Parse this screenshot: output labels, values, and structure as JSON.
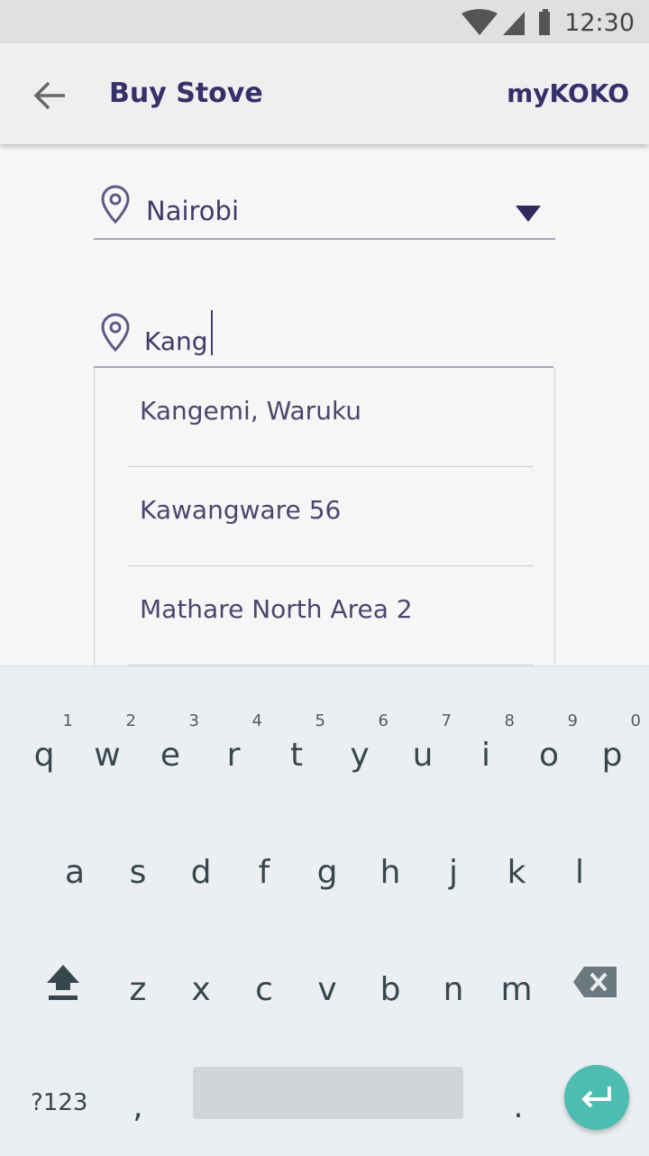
{
  "status_bar": {
    "time": "12:30"
  },
  "app_bar": {
    "title": "Buy Stove",
    "brand": "myKOKO"
  },
  "form": {
    "city_value": "Nairobi",
    "area_value": "Kang"
  },
  "suggestions": [
    "Kangemi, Waruku",
    "Kawangware 56",
    "Mathare North Area 2"
  ],
  "keyboard": {
    "row1": [
      {
        "key": "q",
        "num": "1"
      },
      {
        "key": "w",
        "num": "2"
      },
      {
        "key": "e",
        "num": "3"
      },
      {
        "key": "r",
        "num": "4"
      },
      {
        "key": "t",
        "num": "5"
      },
      {
        "key": "y",
        "num": "6"
      },
      {
        "key": "u",
        "num": "7"
      },
      {
        "key": "i",
        "num": "8"
      },
      {
        "key": "o",
        "num": "9"
      },
      {
        "key": "p",
        "num": "0"
      }
    ],
    "row2": [
      "a",
      "s",
      "d",
      "f",
      "g",
      "h",
      "j",
      "k",
      "l"
    ],
    "row3": [
      "z",
      "x",
      "c",
      "v",
      "b",
      "n",
      "m"
    ],
    "symbols_label": "?123",
    "comma": ",",
    "period": "."
  },
  "colors": {
    "accent": "#36306a",
    "enter_button": "#4cbdb0",
    "keyboard_bg": "#eceff1"
  }
}
